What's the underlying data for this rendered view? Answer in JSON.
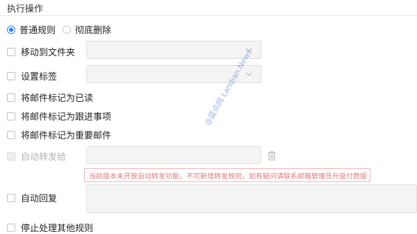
{
  "section": {
    "title": "执行操作"
  },
  "rule_type": {
    "options": [
      {
        "label": "普通规则",
        "selected": true
      },
      {
        "label": "彻底删除",
        "selected": false
      }
    ]
  },
  "actions": {
    "move_to_folder": {
      "label": "移动到文件夹",
      "checked": false
    },
    "set_tag": {
      "label": "设置标签",
      "checked": false
    },
    "mark_read": {
      "label": "将邮件标记为已读",
      "checked": false
    },
    "mark_followup": {
      "label": "将邮件标记为跟进事项",
      "checked": false
    },
    "mark_important": {
      "label": "将邮件标记为重要邮件",
      "checked": false
    },
    "auto_forward": {
      "label": "自动转发给",
      "checked": false,
      "disabled": true
    },
    "auto_forward_notice": "当前版本未开放自动转发功能，不可新增转发规则，如有疑问请联系邮箱管理员升级付费版",
    "auto_reply": {
      "label": "自动回复",
      "checked": false
    },
    "stop_processing": {
      "label": "停止处理其他规则",
      "checked": false
    }
  },
  "watermark": {
    "text": "@蓝点网 Landian.News"
  },
  "colors": {
    "accent": "#2d7df6",
    "warning_text": "#e07a7a",
    "warning_border": "#f3b4b4"
  }
}
